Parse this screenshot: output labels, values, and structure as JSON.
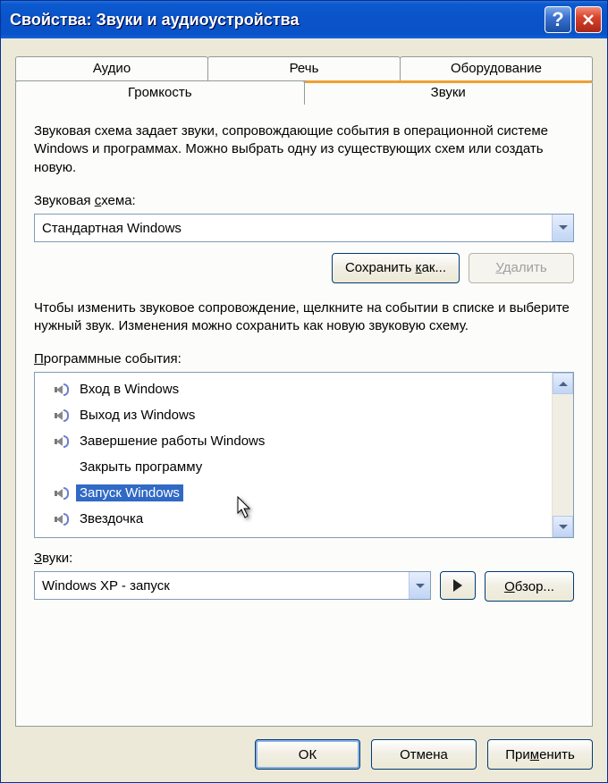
{
  "titlebar": {
    "title": "Свойства: Звуки и аудиоустройства",
    "help": "?",
    "close": "X"
  },
  "tabs": {
    "row1": [
      "Аудио",
      "Речь",
      "Оборудование"
    ],
    "row2": [
      "Громкость",
      "Звуки"
    ],
    "active": "Звуки"
  },
  "scheme": {
    "description": "Звуковая схема задает звуки, сопровождающие события в операционной системе Windows и программах. Можно выбрать одну из существующих схем или создать новую.",
    "label_prefix": "Звуковая ",
    "label_underline": "с",
    "label_suffix": "хема:",
    "value": "Стандартная Windows",
    "save_as_label": "Сохранить как...",
    "save_as_underline": "к",
    "delete_label": "Удалить",
    "delete_underline": "У"
  },
  "events": {
    "description": "Чтобы изменить звуковое сопровождение, щелкните на событии в списке и выберите нужный звук. Изменения можно сохранить как новую звуковую схему.",
    "label_prefix": "",
    "label_underline": "П",
    "label_suffix": "рограммные события:",
    "items": [
      {
        "label": "Вход в Windows",
        "has_sound": true,
        "selected": false
      },
      {
        "label": "Выход из Windows",
        "has_sound": true,
        "selected": false
      },
      {
        "label": "Завершение работы Windows",
        "has_sound": true,
        "selected": false
      },
      {
        "label": "Закрыть программу",
        "has_sound": false,
        "selected": false
      },
      {
        "label": "Запуск Windows",
        "has_sound": true,
        "selected": true
      },
      {
        "label": "Звездочка",
        "has_sound": true,
        "selected": false
      }
    ]
  },
  "sounds": {
    "label_underline": "З",
    "label_suffix": "вуки:",
    "value": "Windows XP - запуск",
    "browse_label": "Обзор...",
    "browse_underline": "О"
  },
  "dialog": {
    "ok": "ОК",
    "cancel": "Отмена",
    "apply_prefix": "При",
    "apply_underline": "м",
    "apply_suffix": "енить"
  }
}
